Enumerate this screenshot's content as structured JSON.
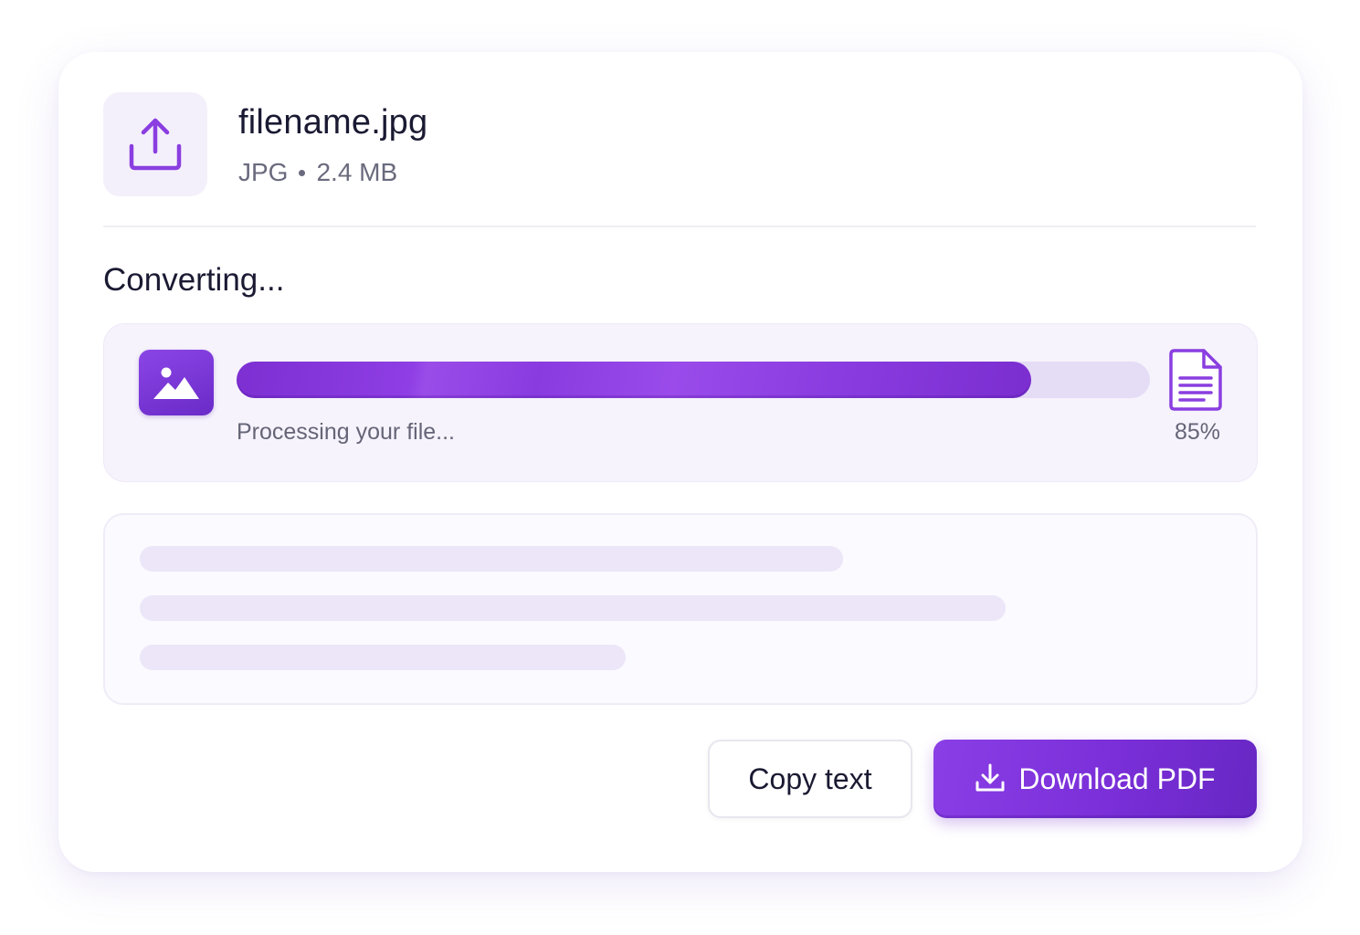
{
  "file": {
    "name": "filename.jpg",
    "type": "JPG",
    "size": "2.4 MB",
    "icon": "upload-icon"
  },
  "conversion": {
    "title": "Converting...",
    "status": "Processing your file...",
    "progress": 0.85,
    "progress_label": "85%",
    "source_icon": "image-icon",
    "target_icon": "document-icon"
  },
  "preview": {
    "state": "loading-skeleton",
    "line_count": 3
  },
  "actions": {
    "copy_label": "Copy text",
    "download_label": "Download PDF",
    "download_icon": "download-icon"
  },
  "colors": {
    "accent": "#7b2fd6",
    "accent_light": "#e5dcf6",
    "panel_bg": "#f6f3fc",
    "text_primary": "#1a1a33",
    "text_secondary": "#6a6a7e"
  }
}
